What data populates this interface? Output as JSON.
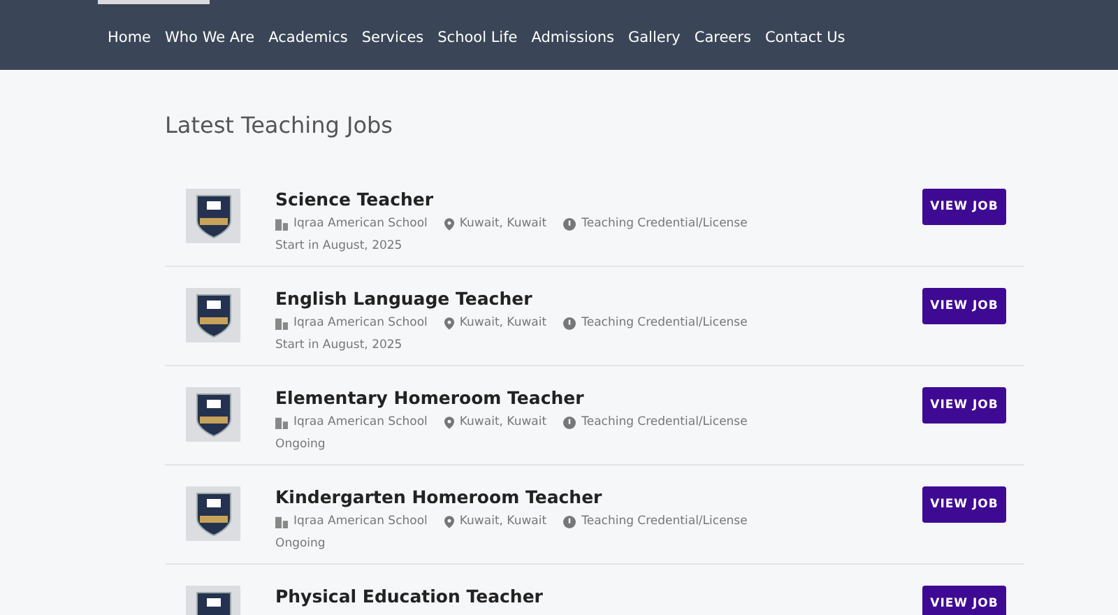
{
  "nav": [
    {
      "label": "Home"
    },
    {
      "label": "Who We Are"
    },
    {
      "label": "Academics"
    },
    {
      "label": "Services"
    },
    {
      "label": "School Life"
    },
    {
      "label": "Admissions"
    },
    {
      "label": "Gallery"
    },
    {
      "label": "Careers"
    },
    {
      "label": "Contact Us"
    }
  ],
  "heading": "Latest Teaching Jobs",
  "jobs": [
    {
      "title": "Science Teacher",
      "school": "Iqraa American School",
      "location": "Kuwait, Kuwait",
      "requirement": "Teaching Credential/License",
      "start": "Start in August, 2025",
      "button": "VIEW JOB"
    },
    {
      "title": "English Language Teacher",
      "school": "Iqraa American School",
      "location": "Kuwait, Kuwait",
      "requirement": "Teaching Credential/License",
      "start": "Start in August, 2025",
      "button": "VIEW JOB"
    },
    {
      "title": "Elementary Homeroom Teacher",
      "school": "Iqraa American School",
      "location": "Kuwait, Kuwait",
      "requirement": "Teaching Credential/License",
      "start": "Ongoing",
      "button": "VIEW JOB"
    },
    {
      "title": "Kindergarten Homeroom Teacher",
      "school": "Iqraa American School",
      "location": "Kuwait, Kuwait",
      "requirement": "Teaching Credential/License",
      "start": "Ongoing",
      "button": "VIEW JOB"
    },
    {
      "title": "Physical Education Teacher",
      "button": "VIEW JOB"
    }
  ]
}
